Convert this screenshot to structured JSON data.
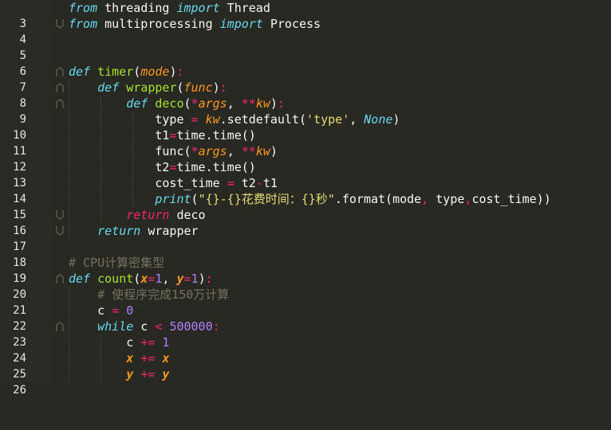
{
  "editor": {
    "lines": [
      {
        "num": "3",
        "text": "from threading import Thread"
      },
      {
        "num": "4",
        "text": "from multiprocessing import Process"
      },
      {
        "num": "5",
        "text": ""
      },
      {
        "num": "6",
        "text": ""
      },
      {
        "num": "7",
        "text": "def timer(mode):"
      },
      {
        "num": "8",
        "text": "    def wrapper(func):"
      },
      {
        "num": "9",
        "text": "        def deco(*args, **kw):"
      },
      {
        "num": "10",
        "text": "            type = kw.setdefault('type', None)"
      },
      {
        "num": "11",
        "text": "            t1=time.time()"
      },
      {
        "num": "12",
        "text": "            func(*args, **kw)"
      },
      {
        "num": "13",
        "text": "            t2=time.time()"
      },
      {
        "num": "14",
        "text": "            cost_time = t2-t1"
      },
      {
        "num": "15",
        "text": "            print(\"{}-{}花费时间：{}秒\".format(mode, type,cost_time))"
      },
      {
        "num": "16",
        "text": "        return deco"
      },
      {
        "num": "17",
        "text": "    return wrapper"
      },
      {
        "num": "18",
        "text": ""
      },
      {
        "num": "19",
        "text": "# CPU计算密集型"
      },
      {
        "num": "20",
        "text": "def count(x=1, y=1):"
      },
      {
        "num": "21",
        "text": "    # 使程序完成150万计算"
      },
      {
        "num": "22",
        "text": "    c = 0"
      },
      {
        "num": "23",
        "text": "    while c < 500000:"
      },
      {
        "num": "24",
        "text": "        c += 1"
      },
      {
        "num": "25",
        "text": "        x += x"
      },
      {
        "num": "26",
        "text": "        y += y"
      }
    ],
    "colors": {
      "background": "#282923",
      "keyword_blue": "#66d9ef",
      "keyword_pink": "#f92672",
      "function_green": "#a6e22e",
      "param_orange": "#fd971f",
      "number_purple": "#ae81ff",
      "string_yellow": "#e6db74",
      "comment_gray": "#75715e"
    }
  }
}
